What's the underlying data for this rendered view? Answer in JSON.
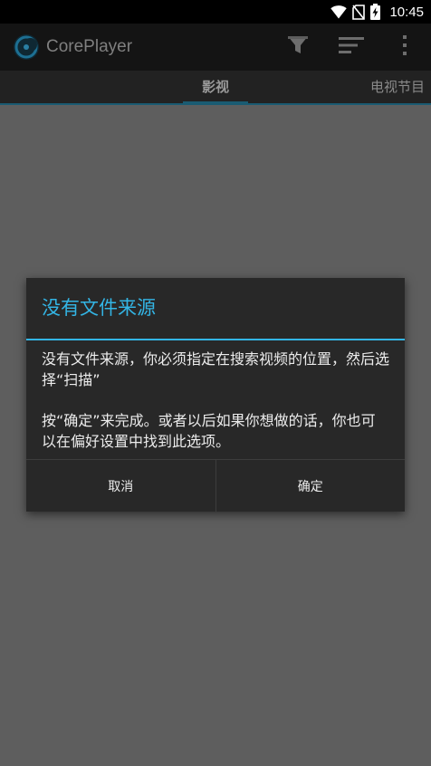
{
  "status_bar": {
    "time": "10:45",
    "icons": [
      "wifi-icon",
      "no-sim-icon",
      "battery-charging-icon"
    ]
  },
  "action_bar": {
    "app_name": "CorePlayer",
    "actions": [
      "filter-icon",
      "sort-icon",
      "overflow-menu-icon"
    ]
  },
  "tabs": {
    "active": "影视",
    "next": "电视节目"
  },
  "dialog": {
    "title": "没有文件来源",
    "message_1": "没有文件来源，你必须指定在搜索视频的位置，然后选择“扫描”",
    "message_2": "按“确定”来完成。或者以后如果你想做的话，你也可以在偏好设置中找到此选项。",
    "cancel_label": "取消",
    "ok_label": "确定"
  },
  "colors": {
    "accent": "#33b5e5",
    "scrim_background": "#5e5e5e",
    "dialog_background": "#282828"
  }
}
